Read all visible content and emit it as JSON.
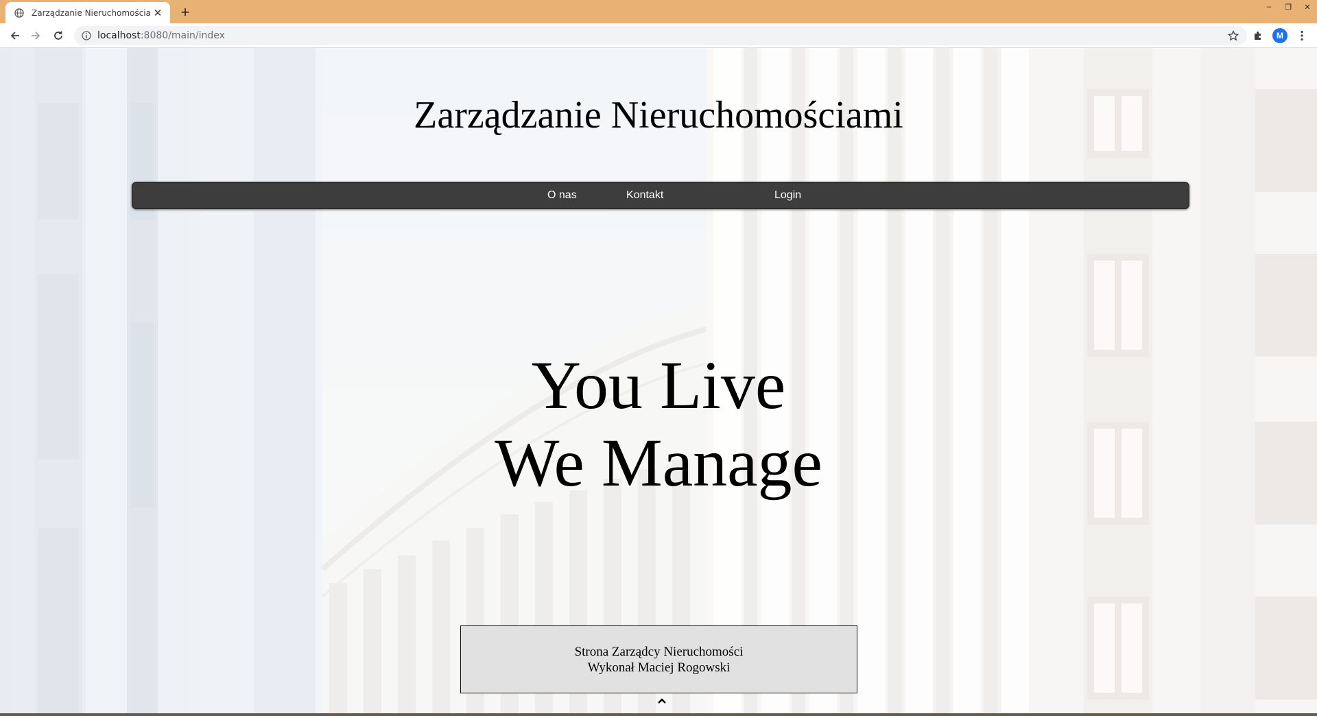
{
  "browser": {
    "tab_title": "Zarządzanie Nieruchomościami",
    "tab_close_symbol": "✕",
    "new_tab_symbol": "+",
    "url_host": "localhost",
    "url_path": ":8080/main/index",
    "profile_initial": "M",
    "window_controls": {
      "minimize": "–",
      "restore": "❐",
      "close": "✕"
    },
    "colors": {
      "tabstrip": "#e9b275",
      "avatar": "#1a73e8"
    }
  },
  "page": {
    "site_title": "Zarządzanie Nieruchomościami",
    "menu": {
      "about": "O nas",
      "contact": "Kontakt",
      "login": "Login"
    },
    "hero": {
      "line1": "You Live",
      "line2": "We Manage"
    },
    "footer": {
      "line1": "Strona Zarządcy Nieruchomości",
      "line2": "Wykonał Maciej Rogowski"
    },
    "colors": {
      "menu_bar": "#3d3d3d",
      "footer_box": "#e1e1e1"
    }
  }
}
